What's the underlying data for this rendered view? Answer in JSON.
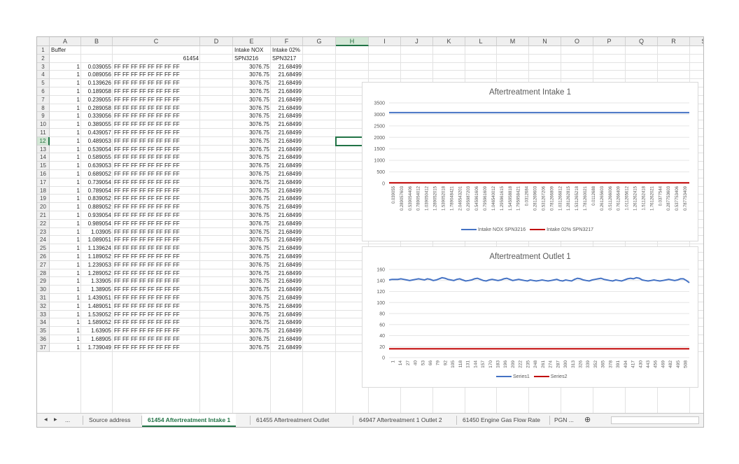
{
  "columns": [
    "A",
    "B",
    "C",
    "D",
    "E",
    "F",
    "G",
    "H",
    "I",
    "J",
    "K",
    "L",
    "M",
    "N",
    "O",
    "P",
    "Q",
    "R",
    "S"
  ],
  "header_row1": {
    "a": "Buffer",
    "e": "Intake NOX",
    "f": "Intake 02%"
  },
  "header_row2": {
    "c": "61454",
    "e": "SPN3216",
    "f": "SPN3217"
  },
  "data_rows": [
    {
      "n": "3",
      "a": "1",
      "b": "0.039055",
      "c": "FF FF FF FF FF FF FF FF",
      "e": "3076.75",
      "f": "21.68499"
    },
    {
      "n": "4",
      "a": "1",
      "b": "0.089056",
      "c": "FF FF FF FF FF FF FF FF",
      "e": "3076.75",
      "f": "21.68499"
    },
    {
      "n": "5",
      "a": "1",
      "b": "0.139626",
      "c": "FF FF FF FF FF FF FF FF",
      "e": "3076.75",
      "f": "21.68499"
    },
    {
      "n": "6",
      "a": "1",
      "b": "0.189058",
      "c": "FF FF FF FF FF FF FF FF",
      "e": "3076.75",
      "f": "21.68499"
    },
    {
      "n": "7",
      "a": "1",
      "b": "0.239055",
      "c": "FF FF FF FF FF FF FF FF",
      "e": "3076.75",
      "f": "21.68499"
    },
    {
      "n": "8",
      "a": "1",
      "b": "0.289058",
      "c": "FF FF FF FF FF FF FF FF",
      "e": "3076.75",
      "f": "21.68499"
    },
    {
      "n": "9",
      "a": "1",
      "b": "0.339056",
      "c": "FF FF FF FF FF FF FF FF",
      "e": "3076.75",
      "f": "21.68499"
    },
    {
      "n": "10",
      "a": "1",
      "b": "0.389055",
      "c": "FF FF FF FF FF FF FF FF",
      "e": "3076.75",
      "f": "21.68499"
    },
    {
      "n": "11",
      "a": "1",
      "b": "0.439057",
      "c": "FF FF FF FF FF FF FF FF",
      "e": "3076.75",
      "f": "21.68499"
    },
    {
      "n": "12",
      "a": "1",
      "b": "0.489053",
      "c": "FF FF FF FF FF FF FF FF",
      "e": "3076.75",
      "f": "21.68499"
    },
    {
      "n": "13",
      "a": "1",
      "b": "0.539054",
      "c": "FF FF FF FF FF FF FF FF",
      "e": "3076.75",
      "f": "21.68499"
    },
    {
      "n": "14",
      "a": "1",
      "b": "0.589055",
      "c": "FF FF FF FF FF FF FF FF",
      "e": "3076.75",
      "f": "21.68499"
    },
    {
      "n": "15",
      "a": "1",
      "b": "0.639053",
      "c": "FF FF FF FF FF FF FF FF",
      "e": "3076.75",
      "f": "21.68499"
    },
    {
      "n": "16",
      "a": "1",
      "b": "0.689052",
      "c": "FF FF FF FF FF FF FF FF",
      "e": "3076.75",
      "f": "21.68499"
    },
    {
      "n": "17",
      "a": "1",
      "b": "0.739054",
      "c": "FF FF FF FF FF FF FF FF",
      "e": "3076.75",
      "f": "21.68499"
    },
    {
      "n": "18",
      "a": "1",
      "b": "0.789054",
      "c": "FF FF FF FF FF FF FF FF",
      "e": "3076.75",
      "f": "21.68499"
    },
    {
      "n": "19",
      "a": "1",
      "b": "0.839052",
      "c": "FF FF FF FF FF FF FF FF",
      "e": "3076.75",
      "f": "21.68499"
    },
    {
      "n": "20",
      "a": "1",
      "b": "0.889052",
      "c": "FF FF FF FF FF FF FF FF",
      "e": "3076.75",
      "f": "21.68499"
    },
    {
      "n": "21",
      "a": "1",
      "b": "0.939054",
      "c": "FF FF FF FF FF FF FF FF",
      "e": "3076.75",
      "f": "21.68499"
    },
    {
      "n": "22",
      "a": "1",
      "b": "0.989054",
      "c": "FF FF FF FF FF FF FF FF",
      "e": "3076.75",
      "f": "21.68499"
    },
    {
      "n": "23",
      "a": "1",
      "b": "1.03905",
      "c": "FF FF FF FF FF FF FF FF",
      "e": "3076.75",
      "f": "21.68499"
    },
    {
      "n": "24",
      "a": "1",
      "b": "1.089051",
      "c": "FF FF FF FF FF FF FF FF",
      "e": "3076.75",
      "f": "21.68499"
    },
    {
      "n": "25",
      "a": "1",
      "b": "1.139624",
      "c": "FF FF FF FF FF FF FF FF",
      "e": "3076.75",
      "f": "21.68499"
    },
    {
      "n": "26",
      "a": "1",
      "b": "1.189052",
      "c": "FF FF FF FF FF FF FF FF",
      "e": "3076.75",
      "f": "21.68499"
    },
    {
      "n": "27",
      "a": "1",
      "b": "1.239053",
      "c": "FF FF FF FF FF FF FF FF",
      "e": "3076.75",
      "f": "21.68499"
    },
    {
      "n": "28",
      "a": "1",
      "b": "1.289052",
      "c": "FF FF FF FF FF FF FF FF",
      "e": "3076.75",
      "f": "21.68499"
    },
    {
      "n": "29",
      "a": "1",
      "b": "1.33905",
      "c": "FF FF FF FF FF FF FF FF",
      "e": "3076.75",
      "f": "21.68499"
    },
    {
      "n": "30",
      "a": "1",
      "b": "1.38905",
      "c": "FF FF FF FF FF FF FF FF",
      "e": "3076.75",
      "f": "21.68499"
    },
    {
      "n": "31",
      "a": "1",
      "b": "1.439051",
      "c": "FF FF FF FF FF FF FF FF",
      "e": "3076.75",
      "f": "21.68499"
    },
    {
      "n": "32",
      "a": "1",
      "b": "1.489051",
      "c": "FF FF FF FF FF FF FF FF",
      "e": "3076.75",
      "f": "21.68499"
    },
    {
      "n": "33",
      "a": "1",
      "b": "1.539052",
      "c": "FF FF FF FF FF FF FF FF",
      "e": "3076.75",
      "f": "21.68499"
    },
    {
      "n": "34",
      "a": "1",
      "b": "1.589052",
      "c": "FF FF FF FF FF FF FF FF",
      "e": "3076.75",
      "f": "21.68499"
    },
    {
      "n": "35",
      "a": "1",
      "b": "1.63905",
      "c": "FF FF FF FF FF FF FF FF",
      "e": "3076.75",
      "f": "21.68499"
    },
    {
      "n": "36",
      "a": "1",
      "b": "1.68905",
      "c": "FF FF FF FF FF FF FF FF",
      "e": "3076.75",
      "f": "21.68499"
    },
    {
      "n": "37",
      "a": "1",
      "b": "1.739049",
      "c": "FF FF FF FF FF FF FF FF",
      "e": "3076.75",
      "f": "21.68499"
    }
  ],
  "selected_cell": {
    "column": "H",
    "row": "12"
  },
  "chart_data": [
    {
      "type": "line",
      "title": "Aftertreatment Intake 1",
      "ylim": [
        0,
        3500
      ],
      "yticks": [
        "3500",
        "3000",
        "2500",
        "2000",
        "1500",
        "1000",
        "500",
        "0"
      ],
      "x_tick_labels": [
        "0.039055",
        "0.289057603",
        "0.539054406",
        "0.789054012",
        "1.039050412",
        "1.289052015",
        "1.539052018",
        "1.789048421",
        "2.046543201",
        "0.295987203",
        "0.545961606",
        "0.795961609",
        "1.046540012",
        "1.295961615",
        "1.545958818",
        "1.795958421",
        "0.0312684",
        "0.281269603",
        "0.531267206",
        "0.781266809",
        "1.031266812",
        "1.281262815",
        "1.531265218",
        "1.781260021",
        "0.0112688",
        "0.261265603",
        "0.511266006",
        "0.761266409",
        "1.011265612",
        "1.261262415",
        "1.511262418",
        "1.761262021",
        "0.0377544",
        "0.287753603",
        "0.537753406",
        "0.787753409"
      ],
      "legend_position": "bottom",
      "series": [
        {
          "name": "Intake NOX SPN3216",
          "color": "#4472C4",
          "constant_value": 3076.75
        },
        {
          "name": "Intake 02% SPN3217",
          "color": "#C00000",
          "constant_value": 21.68499
        }
      ]
    },
    {
      "type": "line",
      "title": "Aftertreatment Outlet 1",
      "ylim": [
        0,
        160
      ],
      "yticks": [
        "160",
        "140",
        "120",
        "100",
        "80",
        "60",
        "40",
        "20",
        "0"
      ],
      "x_tick_labels": [
        "1",
        "14",
        "27",
        "40",
        "53",
        "66",
        "79",
        "92",
        "105",
        "118",
        "131",
        "144",
        "157",
        "170",
        "183",
        "196",
        "209",
        "222",
        "235",
        "248",
        "261",
        "274",
        "287",
        "300",
        "313",
        "326",
        "339",
        "352",
        "365",
        "378",
        "391",
        "404",
        "417",
        "430",
        "443",
        "456",
        "469",
        "482",
        "495",
        "508"
      ],
      "legend_position": "bottom",
      "series": [
        {
          "name": "Series1",
          "color": "#4472C4",
          "values": [
            141,
            142,
            142,
            142,
            143,
            142,
            141,
            140,
            141,
            142,
            143,
            142,
            141,
            143,
            142,
            140,
            141,
            143,
            145,
            144,
            142,
            141,
            140,
            142,
            143,
            141,
            139,
            140,
            141,
            143,
            144,
            142,
            140,
            139,
            141,
            142,
            141,
            140,
            141,
            143,
            144,
            142,
            140,
            141,
            142,
            141,
            140,
            139,
            141,
            140,
            139,
            140,
            141,
            140,
            139,
            140,
            141,
            142,
            140,
            139,
            141,
            140,
            139,
            142,
            144,
            143,
            141,
            140,
            139,
            141,
            142,
            143,
            144,
            142,
            141,
            140,
            139,
            141,
            140,
            139,
            141,
            143,
            144,
            143,
            145,
            144,
            141,
            140,
            139,
            140,
            141,
            140,
            139,
            140,
            141,
            142,
            141,
            140,
            141,
            143,
            143,
            140,
            136
          ]
        },
        {
          "name": "Series2",
          "color": "#C00000",
          "constant_value": 16
        }
      ]
    }
  ],
  "tabs": {
    "nav_prev": "◀",
    "nav_next": "▶",
    "ellipsis": "...",
    "items": [
      {
        "label": "Source address",
        "active": false
      },
      {
        "label": "61454 Aftertreatment Intake 1",
        "active": true
      },
      {
        "label": "61455 Aftertreatment Outlet",
        "active": false
      },
      {
        "label": "64947 Aftertreatment 1 Outlet 2",
        "active": false
      },
      {
        "label": "61450 Engine Gas Flow Rate",
        "active": false
      },
      {
        "label": "PGN ...",
        "active": false
      }
    ],
    "add_sheet": "⊕"
  }
}
